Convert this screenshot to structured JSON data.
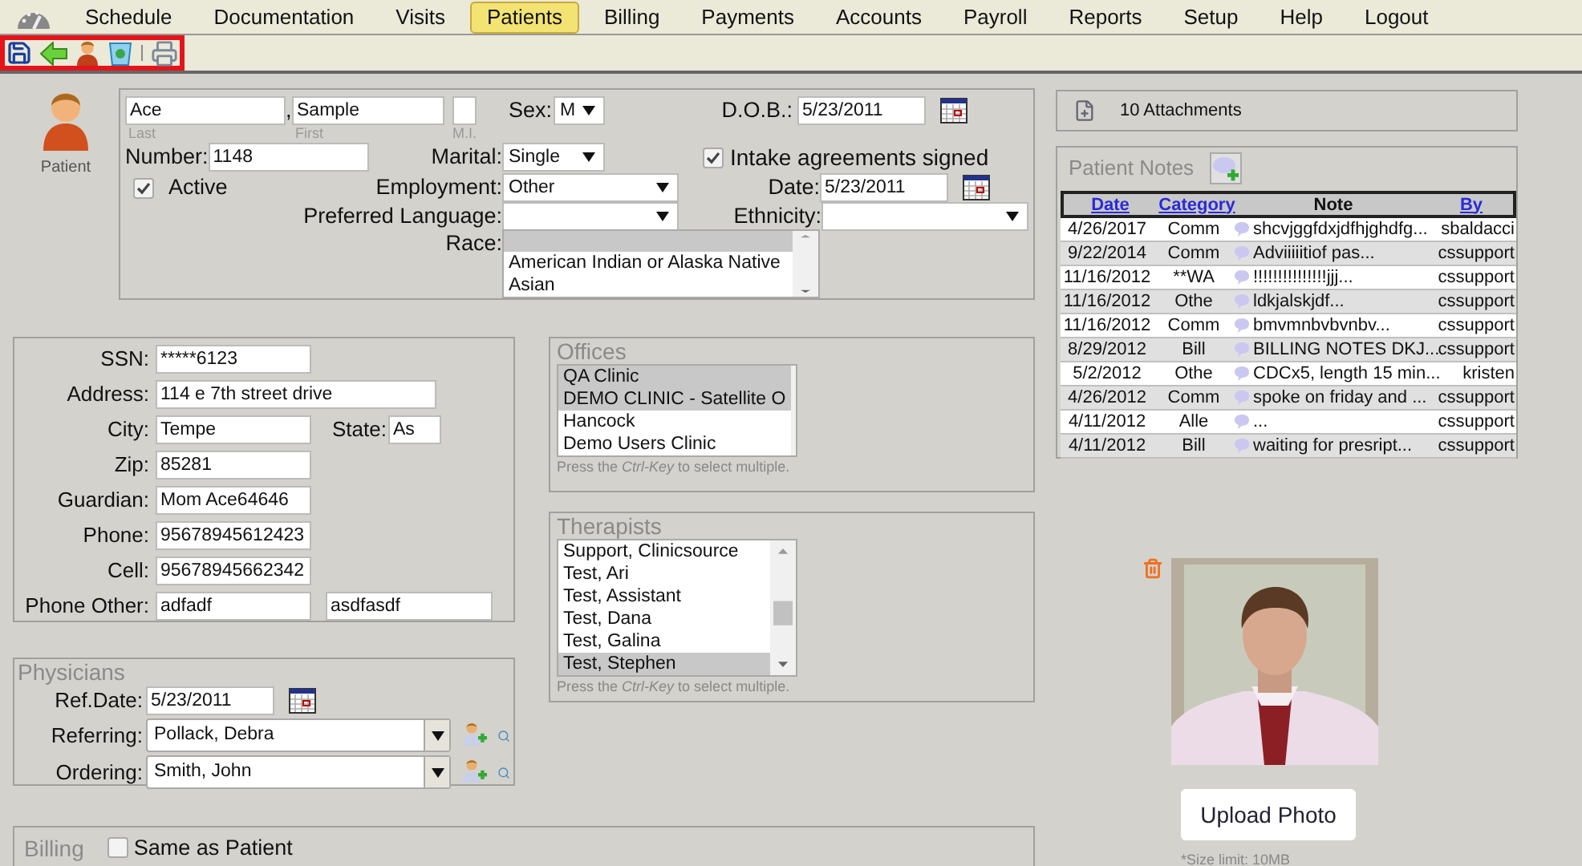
{
  "nav": {
    "items": [
      {
        "label": "Schedule",
        "selected": false
      },
      {
        "label": "Documentation",
        "selected": false
      },
      {
        "label": "Visits",
        "selected": false
      },
      {
        "label": "Patients",
        "selected": true
      },
      {
        "label": "Billing",
        "selected": false
      },
      {
        "label": "Payments",
        "selected": false
      },
      {
        "label": "Accounts",
        "selected": false
      },
      {
        "label": "Payroll",
        "selected": false
      },
      {
        "label": "Reports",
        "selected": false
      },
      {
        "label": "Setup",
        "selected": false
      },
      {
        "label": "Help",
        "selected": false
      },
      {
        "label": "Logout",
        "selected": false
      }
    ]
  },
  "patient_badge": {
    "label": "Patient"
  },
  "demographics": {
    "last": {
      "value": "Ace",
      "caption": "Last"
    },
    "separator": ",",
    "first": {
      "value": "Sample",
      "caption": "First"
    },
    "mi": {
      "caption": "M.I."
    },
    "sex": {
      "label": "Sex:",
      "value": "M"
    },
    "dob": {
      "label": "D.O.B.:",
      "value": "5/23/2011"
    },
    "number": {
      "label": "Number:",
      "value": "1148"
    },
    "marital": {
      "label": "Marital:",
      "value": "Single"
    },
    "intake": {
      "label": "Intake agreements signed",
      "checked": true
    },
    "active": {
      "label": "Active",
      "checked": true
    },
    "employment": {
      "label": "Employment:",
      "value": "Other"
    },
    "intake_date": {
      "label": "Date:",
      "value": "5/23/2011"
    },
    "language": {
      "label": "Preferred Language:"
    },
    "ethnicity": {
      "label": "Ethnicity:"
    },
    "race": {
      "label": "Race:",
      "blank_selected": true,
      "options": [
        {
          "label": "American Indian or Alaska Native",
          "selected": false
        },
        {
          "label": "Asian",
          "selected": false
        }
      ]
    }
  },
  "contact": [
    {
      "label": "SSN:",
      "fields": [
        {
          "value": "*****6123",
          "kind": "short"
        }
      ]
    },
    {
      "label": "Address:",
      "fields": [
        {
          "value": "114 e 7th street drive",
          "kind": "long"
        }
      ]
    },
    {
      "label": "City:",
      "fields": [
        {
          "value": "Tempe",
          "kind": "short"
        },
        {
          "label": "State:",
          "value": "As",
          "kind": "tiny"
        }
      ]
    },
    {
      "label": "Zip:",
      "fields": [
        {
          "value": "85281",
          "kind": "short"
        }
      ]
    },
    {
      "label": "Guardian:",
      "fields": [
        {
          "value": "Mom Ace64646",
          "kind": "short"
        }
      ]
    },
    {
      "label": "Phone:",
      "fields": [
        {
          "value": "95678945612423",
          "kind": "short"
        }
      ]
    },
    {
      "label": "Cell:",
      "fields": [
        {
          "value": "95678945662342",
          "kind": "short"
        }
      ]
    },
    {
      "label": "Phone Other:",
      "fields": [
        {
          "value": "adfadf",
          "kind": "short"
        },
        {
          "value": "asdfasdf",
          "kind": "wide"
        }
      ]
    }
  ],
  "physicians": {
    "title": "Physicians",
    "ref_date": {
      "label": "Ref.Date:",
      "value": "5/23/2011"
    },
    "rows": [
      {
        "label": "Referring:",
        "value": "Pollack, Debra"
      },
      {
        "label": "Ordering:",
        "value": "Smith, John"
      }
    ]
  },
  "offices": {
    "title": "Offices",
    "options": [
      {
        "label": "QA Clinic",
        "selected": true
      },
      {
        "label": "DEMO CLINIC - Satellite O",
        "selected": true
      },
      {
        "label": "Hancock",
        "selected": false
      },
      {
        "label": "Demo Users Clinic",
        "selected": false
      }
    ],
    "hint": "Press the *Ctrl-Key* to select multiple."
  },
  "therapists": {
    "title": "Therapists",
    "options": [
      {
        "label": "Support, Clinicsource",
        "selected": false
      },
      {
        "label": "Test, Ari",
        "selected": false
      },
      {
        "label": "Test, Assistant",
        "selected": false
      },
      {
        "label": "Test, Dana",
        "selected": false
      },
      {
        "label": "Test, Galina",
        "selected": false
      },
      {
        "label": "Test, Stephen",
        "selected": true
      }
    ],
    "hint": "Press the *Ctrl-Key* to select multiple."
  },
  "billing": {
    "title": "Billing",
    "same_as_patient": {
      "label": "Same as Patient",
      "checked": false
    }
  },
  "attachments": {
    "label": "10 Attachments"
  },
  "notes": {
    "title": "Patient Notes",
    "columns": [
      {
        "label": "Date",
        "sortable": true
      },
      {
        "label": "Category",
        "sortable": true
      },
      {
        "label": "Note",
        "sortable": false
      },
      {
        "label": "By",
        "sortable": true
      }
    ],
    "rows": [
      {
        "date": "4/26/2017",
        "category": "Comm",
        "note": "shcvjggfdxjdfhjghdfg...",
        "by": "sbaldacci"
      },
      {
        "date": "9/22/2014",
        "category": "Comm",
        "note": "Adviiiiitiof pas...",
        "by": "cssupport"
      },
      {
        "date": "11/16/2012",
        "category": "**WA",
        "note": "!!!!!!!!!!!!!!!jjj...",
        "by": "cssupport"
      },
      {
        "date": "11/16/2012",
        "category": "Othe",
        "note": "ldkjalskjdf...",
        "by": "cssupport"
      },
      {
        "date": "11/16/2012",
        "category": "Comm",
        "note": "bmvmnbvbvnbv...",
        "by": "cssupport"
      },
      {
        "date": "8/29/2012",
        "category": "Bill",
        "note": "BILLING NOTES DKJ...",
        "by": "cssupport"
      },
      {
        "date": "5/2/2012",
        "category": "Othe",
        "note": "CDCx5, length 15 min...",
        "by": "kristen"
      },
      {
        "date": "4/26/2012",
        "category": "Comm",
        "note": "spoke on friday and ...",
        "by": "cssupport"
      },
      {
        "date": "4/11/2012",
        "category": "Alle",
        "note": "...",
        "by": "cssupport"
      },
      {
        "date": "4/11/2012",
        "category": "Bill",
        "note": "waiting for presript...",
        "by": "cssupport"
      }
    ]
  },
  "photo": {
    "upload_button": "Upload Photo",
    "size_note": "*Size limit: 10MB"
  }
}
